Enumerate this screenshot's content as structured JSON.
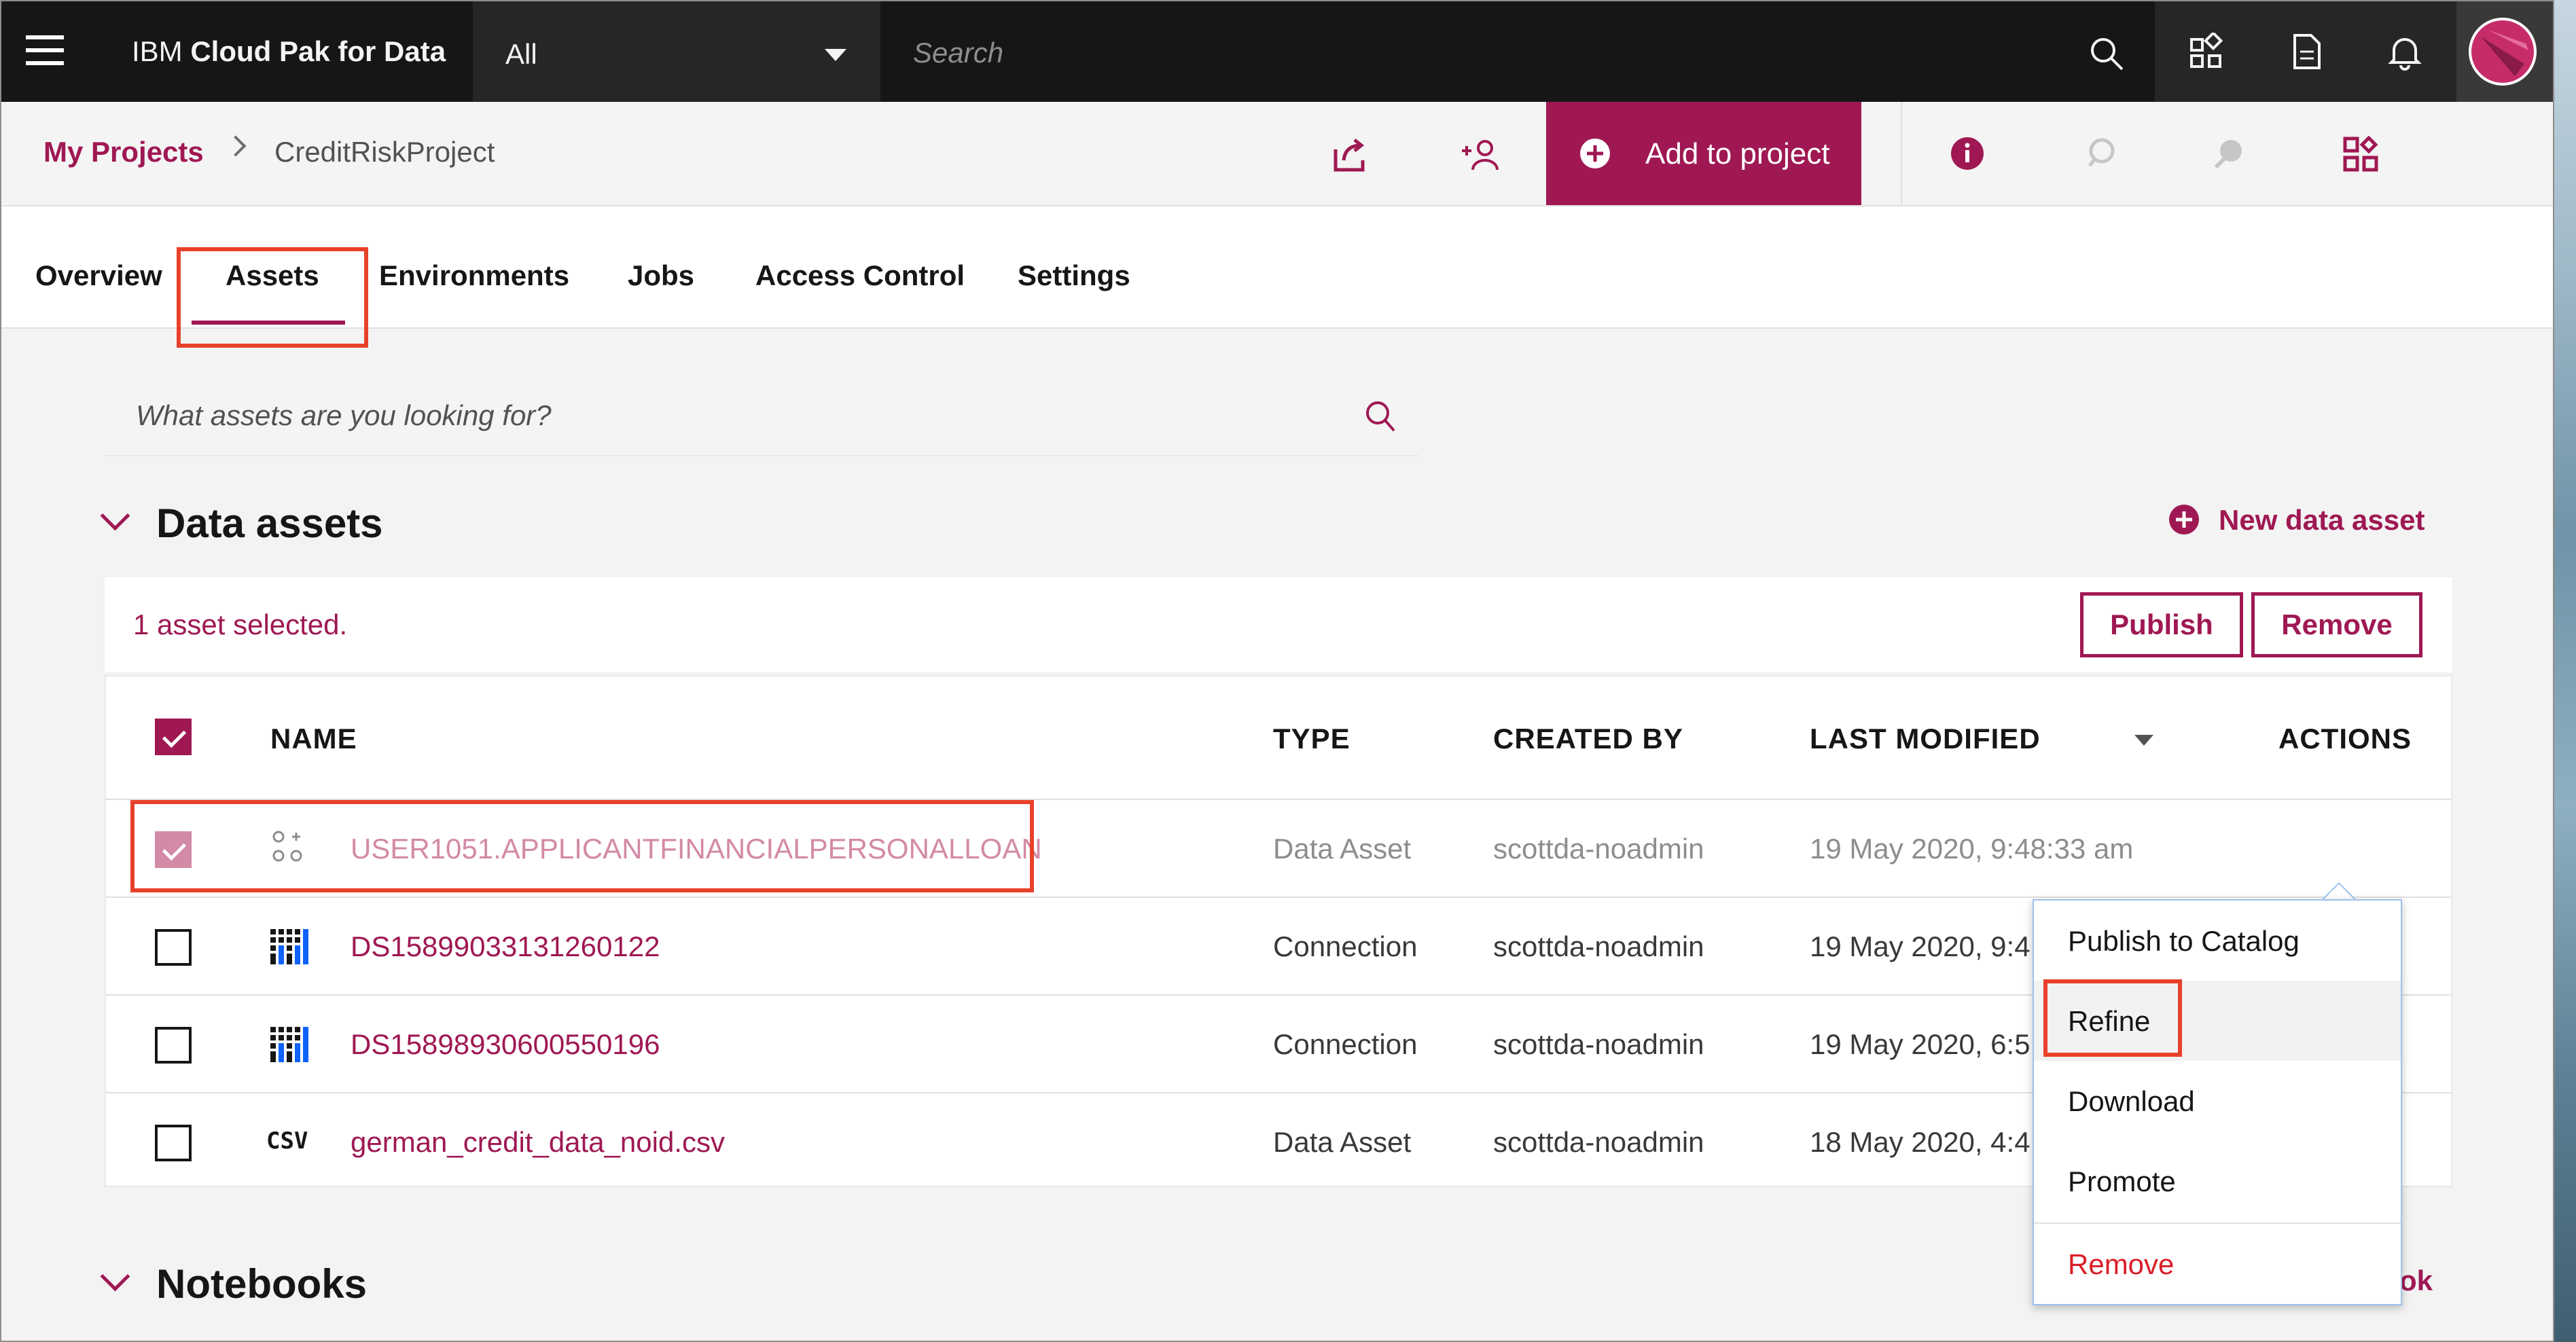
{
  "topbar": {
    "brand_light": "IBM ",
    "brand_bold": "Cloud Pak for Data",
    "scope_value": "All",
    "search_placeholder": "Search"
  },
  "project": {
    "breadcrumb_root": "My Projects",
    "breadcrumb_current": "CreditRiskProject",
    "add_button": "Add to project"
  },
  "tabs": [
    "Overview",
    "Assets",
    "Environments",
    "Jobs",
    "Access Control",
    "Settings"
  ],
  "active_tab": "Assets",
  "asset_search": {
    "placeholder": "What assets are you looking for?"
  },
  "data_assets": {
    "title": "Data assets",
    "new_label": "New data asset",
    "selection_text": "1 asset selected.",
    "publish_label": "Publish",
    "remove_label": "Remove",
    "columns": [
      "NAME",
      "TYPE",
      "CREATED BY",
      "LAST MODIFIED",
      "ACTIONS"
    ],
    "rows": [
      {
        "name": "USER1051.APPLICANTFINANCIALPERSONALLOAN",
        "type": "Data Asset",
        "created_by": "scottda-noadmin",
        "modified": "19 May 2020, 9:48:33 am",
        "icon": "data-asset-icon",
        "checked": true
      },
      {
        "name": "DS15899033131260122",
        "type": "Connection",
        "created_by": "scottda-noadmin",
        "modified": "19 May 2020, 9:4",
        "icon": "connection-icon",
        "checked": false
      },
      {
        "name": "DS15898930600550196",
        "type": "Connection",
        "created_by": "scottda-noadmin",
        "modified": "19 May 2020, 6:5",
        "icon": "connection-icon",
        "checked": false
      },
      {
        "name": "german_credit_data_noid.csv",
        "type": "Data Asset",
        "created_by": "scottda-noadmin",
        "modified": "18 May 2020, 4:4",
        "icon": "csv-file-icon",
        "icon_text": "CSV",
        "checked": false
      }
    ]
  },
  "overflow_menu": {
    "items": [
      "Publish to Catalog",
      "Refine",
      "Download",
      "Promote",
      "Remove"
    ]
  },
  "notebooks": {
    "title": "Notebooks",
    "new_label_peek": "ok"
  },
  "colors": {
    "brand": "#9f1853",
    "topbar": "#161616",
    "highlight": "#e8412b",
    "danger": "#da1e28"
  }
}
